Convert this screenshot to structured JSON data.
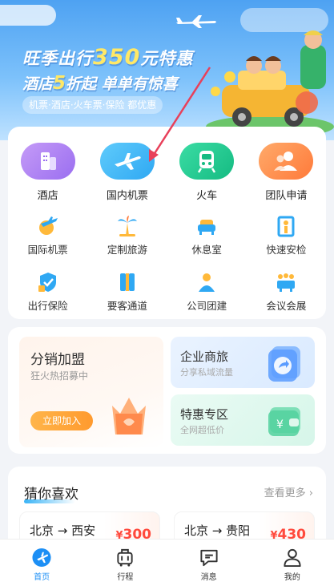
{
  "banner": {
    "title_a": "旺季出行",
    "title_num": "350",
    "title_b": "元特惠",
    "sub_a": "酒店",
    "sub_num": "5",
    "sub_b": "折起 单单有惊喜",
    "tags": "机票·酒店·火车票·保险 都优惠"
  },
  "main_services": [
    {
      "label": "酒店",
      "icon": "hotel-building-icon",
      "color": "#a77ef0"
    },
    {
      "label": "国内机票",
      "icon": "airplane-icon",
      "color": "#3ab4f5"
    },
    {
      "label": "火车",
      "icon": "train-icon",
      "color": "#22c98f"
    },
    {
      "label": "团队申请",
      "icon": "group-icon",
      "color": "#ff8c4a"
    }
  ],
  "sub_services_row1": [
    {
      "label": "国际机票",
      "icon": "globe-plane-icon"
    },
    {
      "label": "定制旅游",
      "icon": "palm-tree-icon"
    },
    {
      "label": "休息室",
      "icon": "sofa-icon"
    },
    {
      "label": "快速安检",
      "icon": "security-gate-icon"
    }
  ],
  "sub_services_row2": [
    {
      "label": "出行保险",
      "icon": "shield-check-icon"
    },
    {
      "label": "要客通道",
      "icon": "vip-lane-icon"
    },
    {
      "label": "公司团建",
      "icon": "team-building-icon"
    },
    {
      "label": "会议会展",
      "icon": "conference-icon"
    }
  ],
  "promo": {
    "left_title": "分销加盟",
    "left_sub": "狂火热招募中",
    "join_label": "立即加入",
    "biz_title": "企业商旅",
    "biz_sub": "分享私域流量",
    "deal_title": "特惠专区",
    "deal_sub": "全网超低价"
  },
  "recommend": {
    "title": "猜你喜欢",
    "more": "查看更多 ›",
    "routes": [
      {
        "path": "北京 → 西安",
        "yen": "¥",
        "price": "300"
      },
      {
        "path": "北京 → 贵阳",
        "yen": "¥",
        "price": "430"
      }
    ]
  },
  "tabs": [
    {
      "label": "首页",
      "icon": "home-plane-icon",
      "active": true
    },
    {
      "label": "行程",
      "icon": "luggage-icon",
      "active": false
    },
    {
      "label": "消息",
      "icon": "message-icon",
      "active": false
    },
    {
      "label": "我的",
      "icon": "user-icon",
      "active": false
    }
  ],
  "colors": {
    "accent": "#1d8ff5",
    "price": "#ff4a3d",
    "join": "#ff9a2e"
  }
}
